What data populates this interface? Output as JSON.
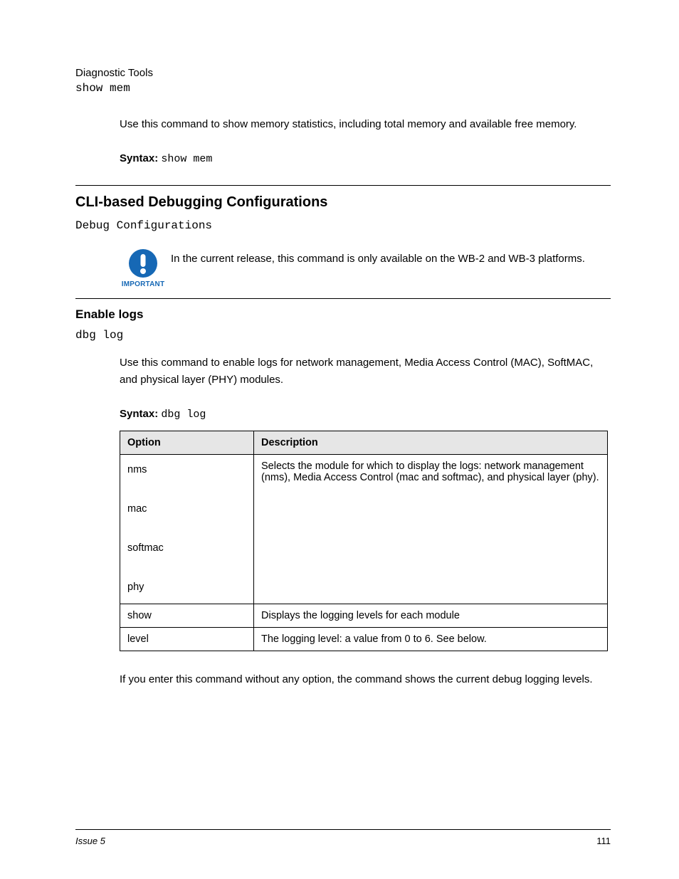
{
  "header": {
    "title": "Diagnostic Tools",
    "command": "show mem"
  },
  "intro": "Use this command to show memory statistics, including total memory and available free memory.",
  "syntax": {
    "label": "Syntax:",
    "value": "show mem"
  },
  "section1": {
    "heading": "CLI-based Debugging Configurations",
    "sub": "Debug Configurations"
  },
  "callout": {
    "icon_label": "IMPORTANT",
    "text": "In the current release, this command is only available on the WB-2 and WB-3 platforms."
  },
  "section2": {
    "heading": "Enable logs",
    "sub": "dbg log",
    "description": "Use this command to enable logs for network management, Media Access Control (MAC), SoftMAC, and physical layer (PHY) modules."
  },
  "table": {
    "caption": {
      "label": "Syntax:",
      "value": "dbg log"
    },
    "headers": [
      "Option",
      "Description"
    ],
    "rows": [
      {
        "option": "nms\n\nmac\n\nsoftmac\n\nphy",
        "description": "Selects the module for which to display the logs: network management (nms), Media Access Control (mac and softmac), and physical layer (phy)."
      },
      {
        "option": "show",
        "description": "Displays the logging levels for each module"
      },
      {
        "option": "level",
        "description": "The logging level: a value from 0 to 6. See below."
      }
    ]
  },
  "post_table": "If you enter this command without any option, the command shows the current debug logging levels.",
  "footer": {
    "left": "Issue 5",
    "right": "111"
  }
}
